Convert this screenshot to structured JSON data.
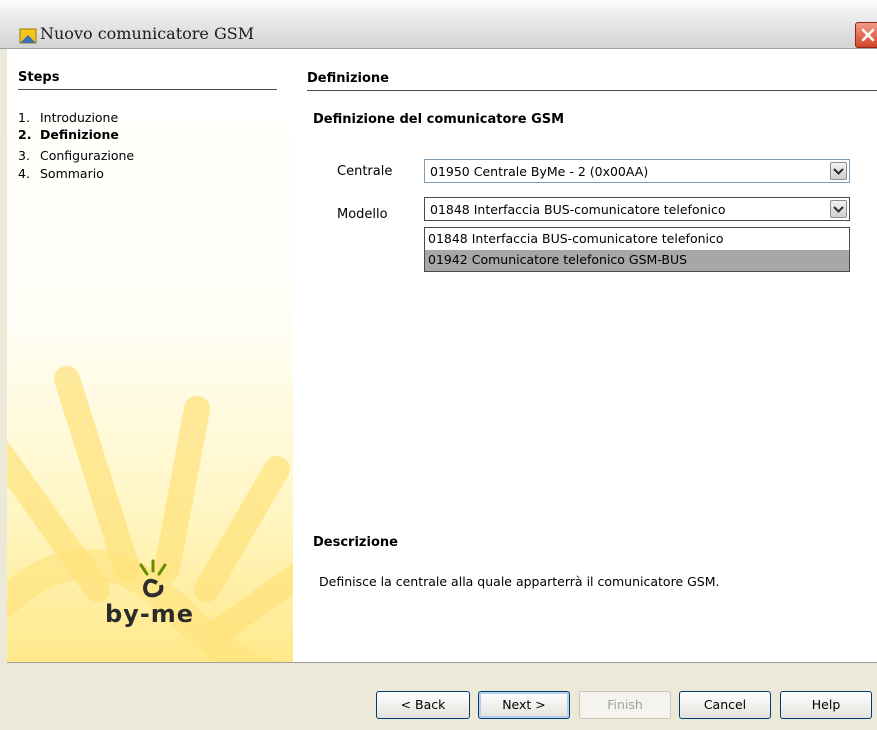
{
  "window": {
    "title": "Nuovo comunicatore GSM",
    "close_glyph": "✕"
  },
  "steps": {
    "title": "Steps",
    "items": [
      {
        "num": "1.",
        "label": "Introduzione"
      },
      {
        "num": "2.",
        "label": "Definizione"
      },
      {
        "num": "3.",
        "label": "Configurazione"
      },
      {
        "num": "4.",
        "label": "Sommario"
      }
    ],
    "current_index": 1
  },
  "logo": {
    "text": "by-me"
  },
  "main": {
    "section_title": "Definizione",
    "subtitle": "Definizione del comunicatore GSM",
    "centrale": {
      "label": "Centrale",
      "value": "01950 Centrale ByMe - 2 (0x00AA)"
    },
    "modello": {
      "label": "Modello",
      "value": "01848 Interfaccia BUS-comunicatore telefonico",
      "options": [
        "01848 Interfaccia BUS-comunicatore telefonico",
        "01942 Comunicatore telefonico GSM-BUS"
      ],
      "highlighted_index": 1
    },
    "description_title": "Descrizione",
    "description_text": "Definisce la centrale alla quale apparterrà il comunicatore GSM."
  },
  "buttons": {
    "back": "< Back",
    "next": "Next >",
    "finish": "Finish",
    "cancel": "Cancel",
    "help": "Help"
  },
  "colors": {
    "accent_yellow": "#ffd84a",
    "selection_gray": "#a7a7a7"
  }
}
